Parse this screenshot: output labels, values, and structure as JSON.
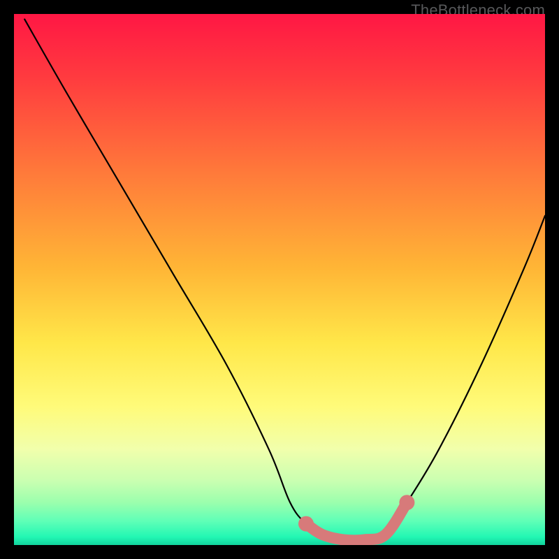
{
  "watermark": "TheBottleneck.com",
  "chart_data": {
    "type": "line",
    "title": "",
    "xlabel": "",
    "ylabel": "",
    "xlim": [
      0,
      100
    ],
    "ylim": [
      0,
      100
    ],
    "grid": false,
    "legend": false,
    "background_gradient_stops": [
      {
        "offset": 0.0,
        "color": "#ff1744"
      },
      {
        "offset": 0.12,
        "color": "#ff3b3f"
      },
      {
        "offset": 0.3,
        "color": "#ff7a3a"
      },
      {
        "offset": 0.48,
        "color": "#ffb636"
      },
      {
        "offset": 0.62,
        "color": "#ffe749"
      },
      {
        "offset": 0.74,
        "color": "#fffb7a"
      },
      {
        "offset": 0.82,
        "color": "#f1ffac"
      },
      {
        "offset": 0.88,
        "color": "#c9ffb1"
      },
      {
        "offset": 0.92,
        "color": "#9bffad"
      },
      {
        "offset": 0.955,
        "color": "#5fffb7"
      },
      {
        "offset": 0.985,
        "color": "#22f7b3"
      },
      {
        "offset": 1.0,
        "color": "#11d39d"
      }
    ],
    "series": [
      {
        "name": "bottleneck-curve",
        "color": "#000000",
        "x": [
          2,
          10,
          20,
          30,
          40,
          48,
          52,
          55,
          58,
          62,
          66,
          70,
          74,
          80,
          88,
          96,
          100
        ],
        "y": [
          99,
          85,
          68,
          51,
          34,
          18,
          8,
          4,
          2,
          1,
          1,
          2,
          8,
          18,
          34,
          52,
          62
        ]
      }
    ],
    "highlight_segment": {
      "name": "flat-bottom",
      "color": "#d77a7a",
      "stroke_width_px": 16,
      "endpoint_radius_px": 11,
      "x": [
        55,
        58,
        62,
        66,
        70,
        74
      ],
      "y": [
        4,
        2,
        1,
        1,
        2,
        8
      ]
    }
  }
}
